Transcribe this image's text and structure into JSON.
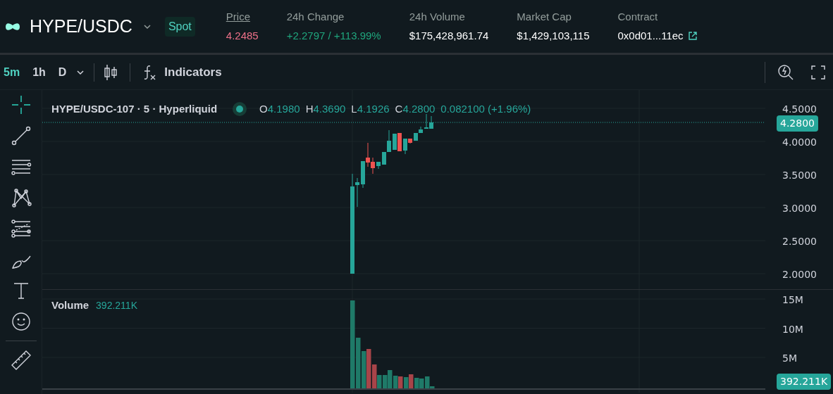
{
  "header": {
    "pair": "HYPE/USDC",
    "market_type": "Spot",
    "stats": [
      {
        "label": "Price",
        "value": "4.2485",
        "kind": "price"
      },
      {
        "label": "24h Change",
        "value": "+2.2797 / +113.99%",
        "kind": "change"
      },
      {
        "label": "24h Volume",
        "value": "$175,428,961.74",
        "kind": "plain"
      },
      {
        "label": "Market Cap",
        "value": "$1,429,103,115",
        "kind": "plain"
      },
      {
        "label": "Contract",
        "value": "0x0d01...11ec",
        "kind": "link"
      }
    ]
  },
  "toolbar": {
    "intervals": [
      {
        "label": "5m",
        "selected": true
      },
      {
        "label": "1h",
        "selected": false
      },
      {
        "label": "D",
        "selected": false
      }
    ],
    "indicators_label": "Indicators"
  },
  "drawing_tools": [
    {
      "kind": "crosshair",
      "selected": true
    },
    {
      "kind": "trend-line",
      "selected": false
    },
    {
      "kind": "horizontal-lines",
      "selected": false
    },
    {
      "kind": "pattern",
      "selected": false
    },
    {
      "kind": "fib",
      "selected": false
    },
    {
      "kind": "brush",
      "selected": false
    },
    {
      "kind": "text",
      "selected": false
    },
    {
      "kind": "emoji",
      "selected": false
    },
    {
      "kind": "ruler",
      "selected": false
    }
  ],
  "chart": {
    "legend": {
      "symbol": "HYPE/USDC-107 · 5 · Hyperliquid",
      "ohlc": [
        {
          "key": "O",
          "value": "4.1980"
        },
        {
          "key": "H",
          "value": "4.3690"
        },
        {
          "key": "L",
          "value": "4.1926"
        },
        {
          "key": "C",
          "value": "4.2800"
        }
      ],
      "change": "0.082100 (+1.96%)"
    },
    "price_ticks": [
      "4.5000",
      "4.0000",
      "3.5000",
      "3.0000",
      "2.5000",
      "2.0000"
    ],
    "last_price": "4.2800",
    "volume": {
      "label": "Volume",
      "value": "392.211K",
      "ticks": [
        "15M",
        "10M",
        "5M"
      ],
      "last": "392.211K"
    }
  }
}
